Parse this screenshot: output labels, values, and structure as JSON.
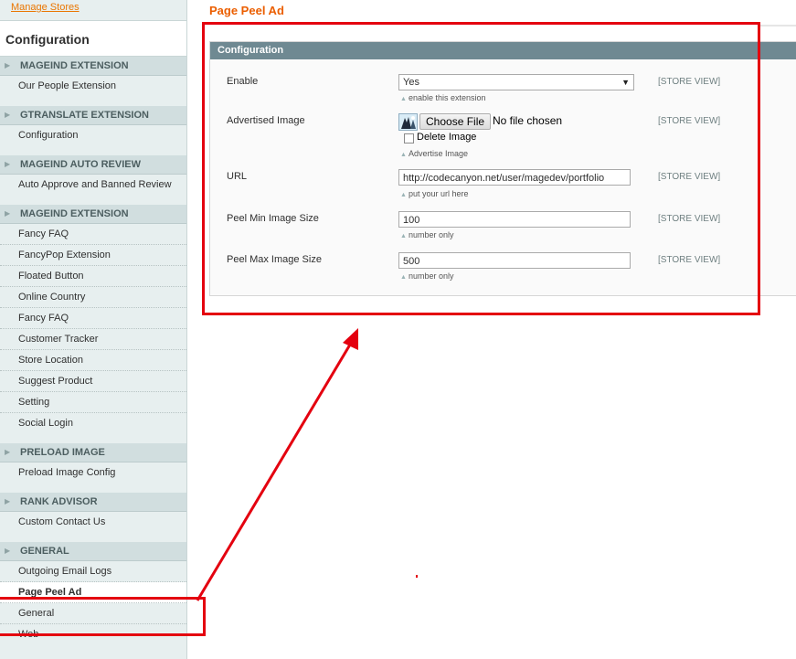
{
  "sidebar": {
    "manage_stores": "Manage Stores",
    "config_title": "Configuration",
    "sections": [
      {
        "title": "MAGEIND EXTENSION",
        "items": [
          "Our People Extension"
        ]
      },
      {
        "title": "GTRANSLATE EXTENSION",
        "items": [
          "Configuration"
        ]
      },
      {
        "title": "MAGEIND AUTO REVIEW",
        "items": [
          "Auto Approve and Banned Review"
        ]
      },
      {
        "title": "MAGEIND EXTENSION",
        "items": [
          "Fancy FAQ",
          "FancyPop Extension",
          "Floated Button",
          "Online Country",
          "Fancy FAQ",
          "Customer Tracker",
          "Store Location",
          "Suggest Product",
          "Setting",
          "Social Login"
        ]
      },
      {
        "title": "PRELOAD IMAGE",
        "items": [
          "Preload Image Config"
        ]
      },
      {
        "title": "RANK ADVISOR",
        "items": [
          "Custom Contact Us"
        ]
      },
      {
        "title": "GENERAL",
        "items": [
          "Outgoing Email Logs",
          "Page Peel Ad",
          "General",
          "Web"
        ]
      }
    ],
    "active_item": "Page Peel Ad"
  },
  "page": {
    "title": "Page Peel Ad",
    "panel_title": "Configuration",
    "fields": {
      "enable": {
        "label": "Enable",
        "value": "Yes",
        "hint": "enable this extension",
        "scope": "[STORE VIEW]"
      },
      "image": {
        "label": "Advertised Image",
        "button": "Choose File",
        "status": "No file chosen",
        "delete_label": "Delete Image",
        "hint": "Advertise Image",
        "scope": "[STORE VIEW]"
      },
      "url": {
        "label": "URL",
        "value": "http://codecanyon.net/user/magedev/portfolio",
        "hint": "put your url here",
        "scope": "[STORE VIEW]"
      },
      "min_size": {
        "label": "Peel Min Image Size",
        "value": "100",
        "hint": "number only",
        "scope": "[STORE VIEW]"
      },
      "max_size": {
        "label": "Peel Max Image Size",
        "value": "500",
        "hint": "number only",
        "scope": "[STORE VIEW]"
      }
    }
  },
  "icons": {
    "section_arrow": "triangle-right-icon",
    "hint_marker": "triangle-up-icon",
    "select_caret": "triangle-down-icon",
    "thumbnail": "advertised-image-thumbnail"
  },
  "colors": {
    "accent": "#eb5e00",
    "panel_header": "#6f8992",
    "sidebar_bg": "#e7efef",
    "section_bg": "#d1dedf",
    "annotation": "#e4000f"
  }
}
